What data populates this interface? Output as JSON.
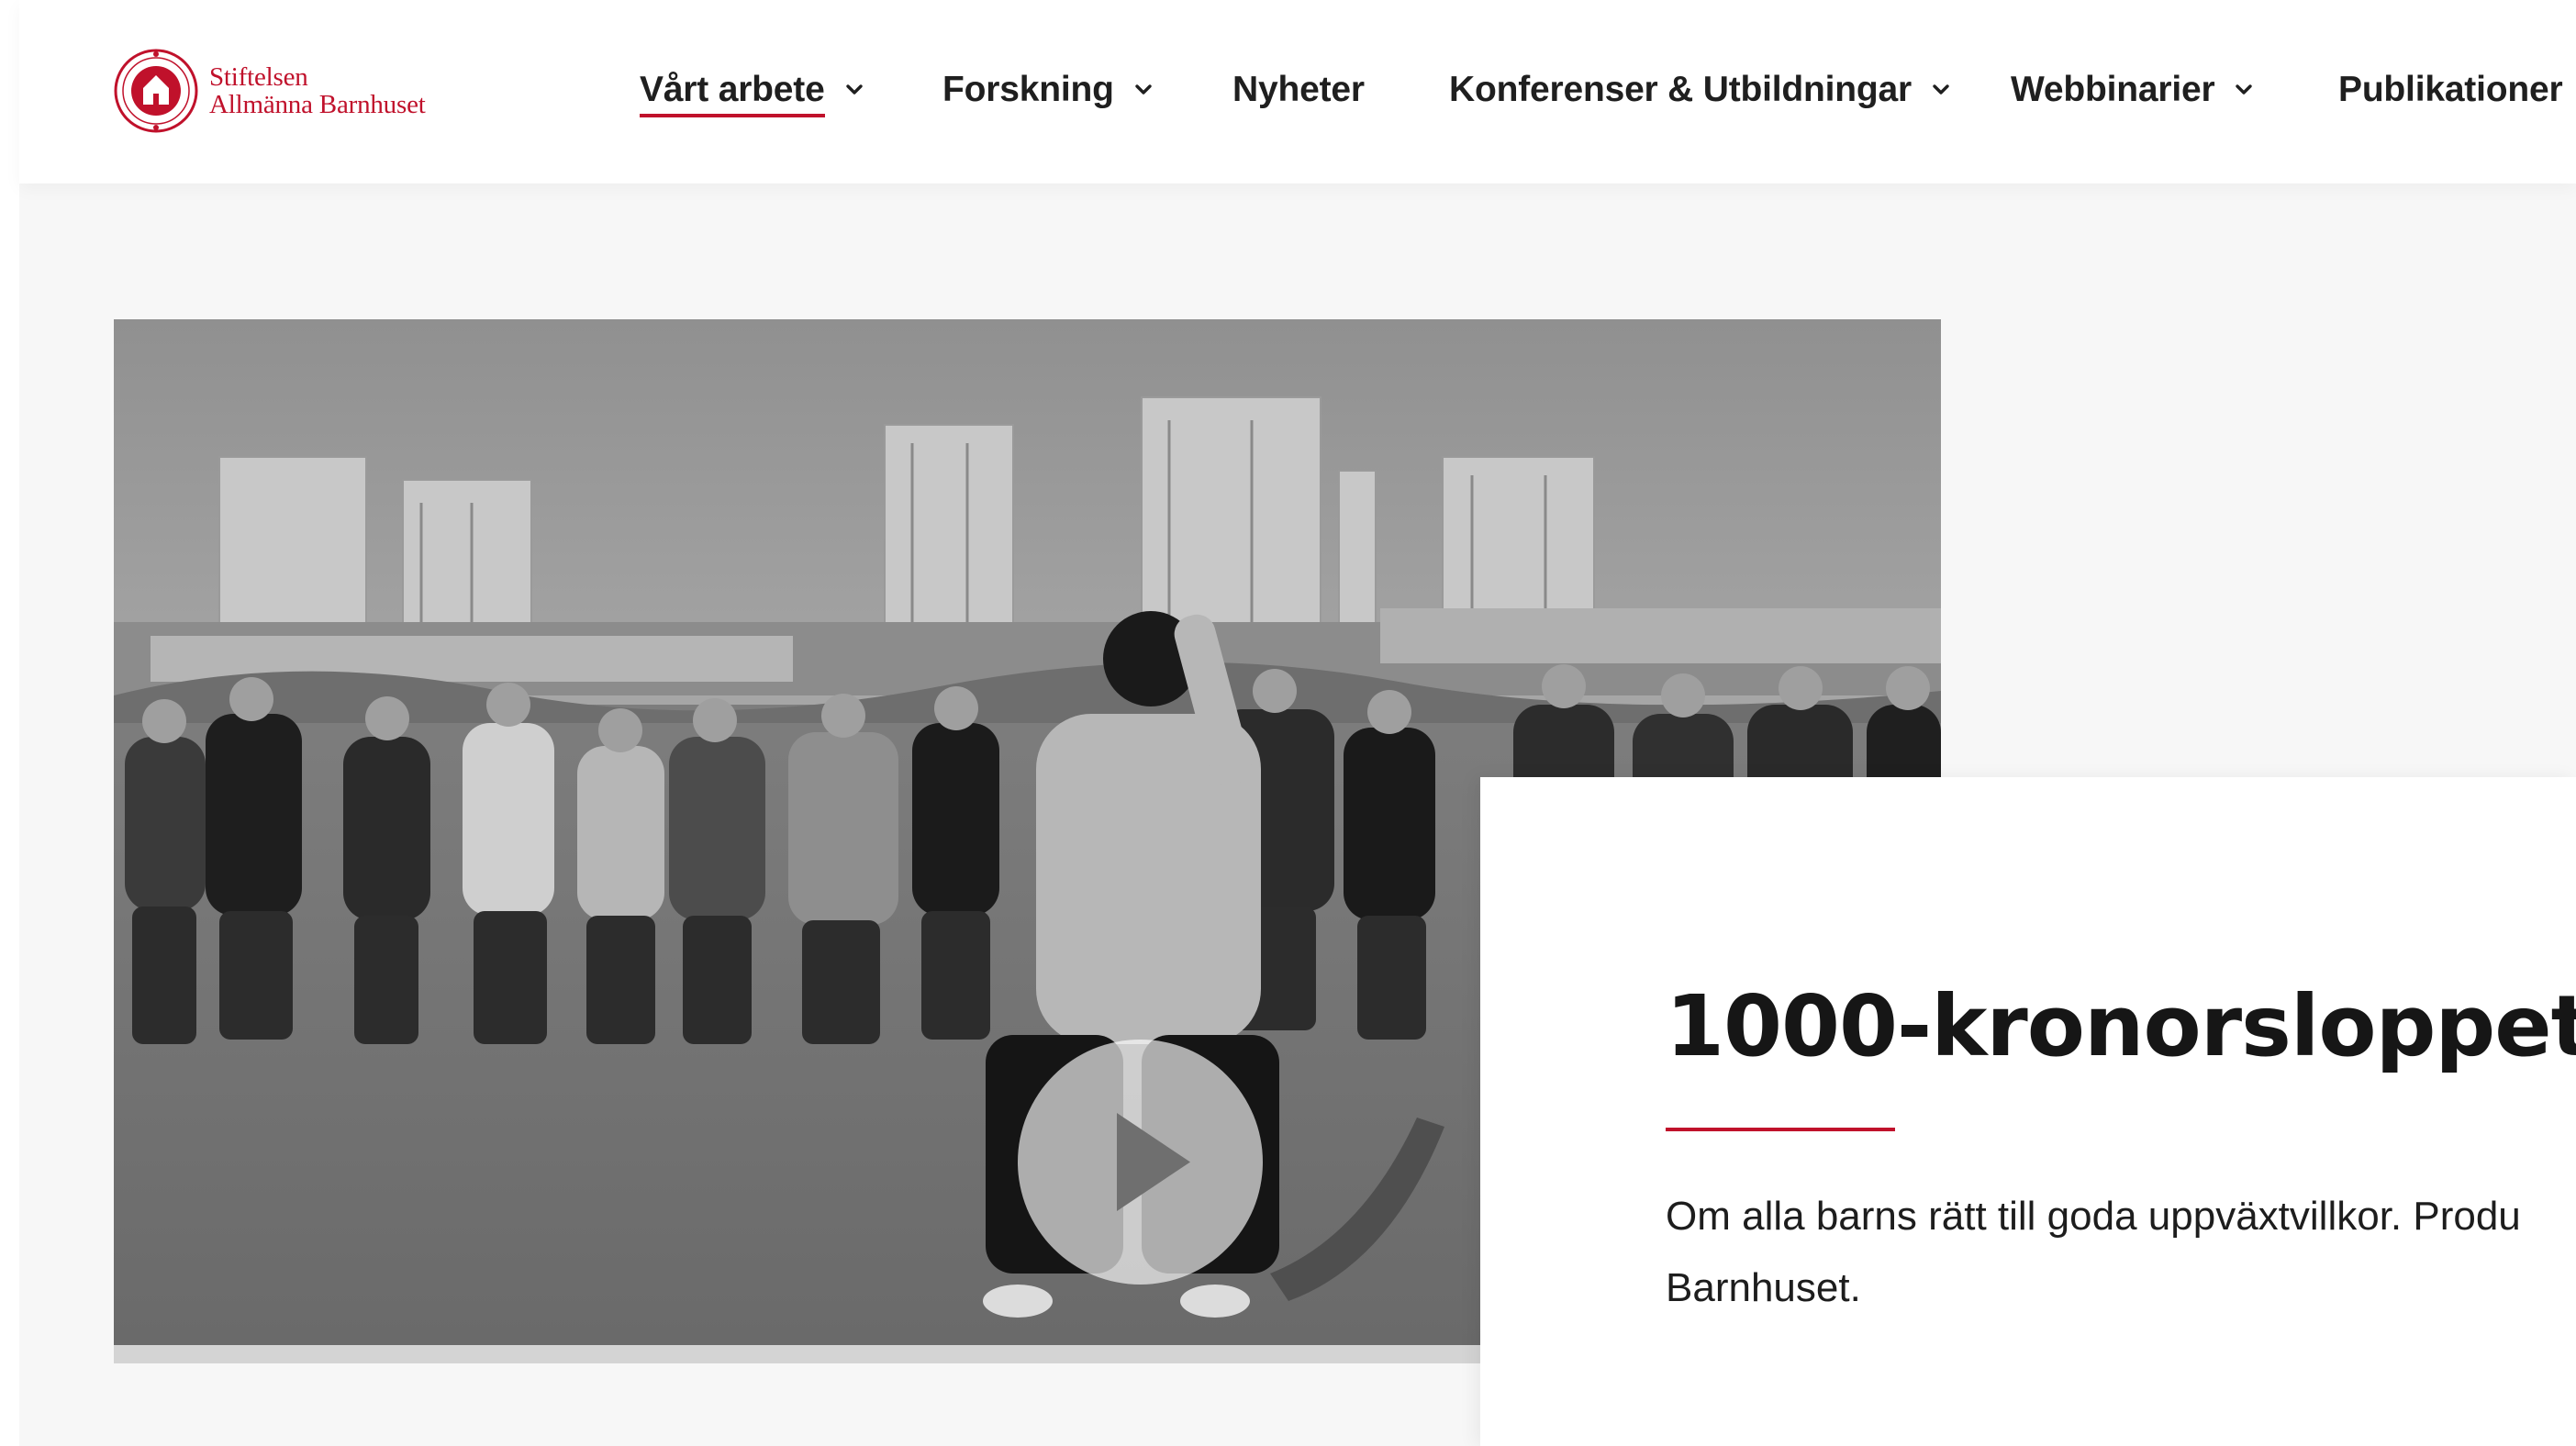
{
  "brand": {
    "line1": "Stiftelsen",
    "line2": "Allmänna Barnhuset",
    "color": "#c0112b"
  },
  "nav": {
    "items": [
      {
        "label": "Vårt arbete",
        "dropdown": true,
        "active": true
      },
      {
        "label": "Forskning",
        "dropdown": true
      },
      {
        "label": "Nyheter",
        "dropdown": false
      },
      {
        "label": "Konferenser & Utbildningar",
        "dropdown": true
      },
      {
        "label": "Webbinarier",
        "dropdown": true
      },
      {
        "label": "Publikationer",
        "dropdown": false
      }
    ]
  },
  "video": {
    "play_icon": "play-icon",
    "overlay": "grayscale"
  },
  "card": {
    "title": "1000-kronorsloppet",
    "description": "Om alla barns rätt till goda uppväxtvillkor. Produ",
    "description_line2": "Barnhuset."
  }
}
